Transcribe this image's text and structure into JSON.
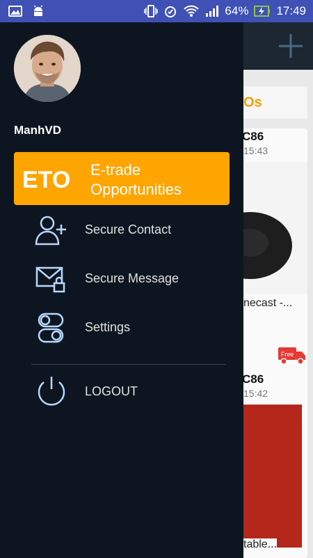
{
  "status_bar": {
    "battery": "64%",
    "time": "17:49"
  },
  "background": {
    "section_title": "Os",
    "cards": [
      {
        "code": "C86",
        "time": "15:43",
        "name": "necast -...",
        "badge": "Free"
      },
      {
        "code": "C86",
        "time": "15:42",
        "name": "table..."
      }
    ]
  },
  "drawer": {
    "user": {
      "name": "ManhVD"
    },
    "featured": {
      "logo_text": "ETO",
      "label": "E-trade Opportunities"
    },
    "items": [
      {
        "label": "Secure Contact",
        "icon": "add-user-icon"
      },
      {
        "label": "Secure Message",
        "icon": "envelope-lock-icon"
      },
      {
        "label": "Settings",
        "icon": "toggle-settings-icon"
      }
    ],
    "logout": {
      "label": "LOGOUT",
      "icon": "power-icon"
    }
  },
  "colors": {
    "status_bar": "#3f51b5",
    "drawer_bg": "#0d1620",
    "accent": "#ffa500",
    "icon_color": "#b9d7ff"
  }
}
